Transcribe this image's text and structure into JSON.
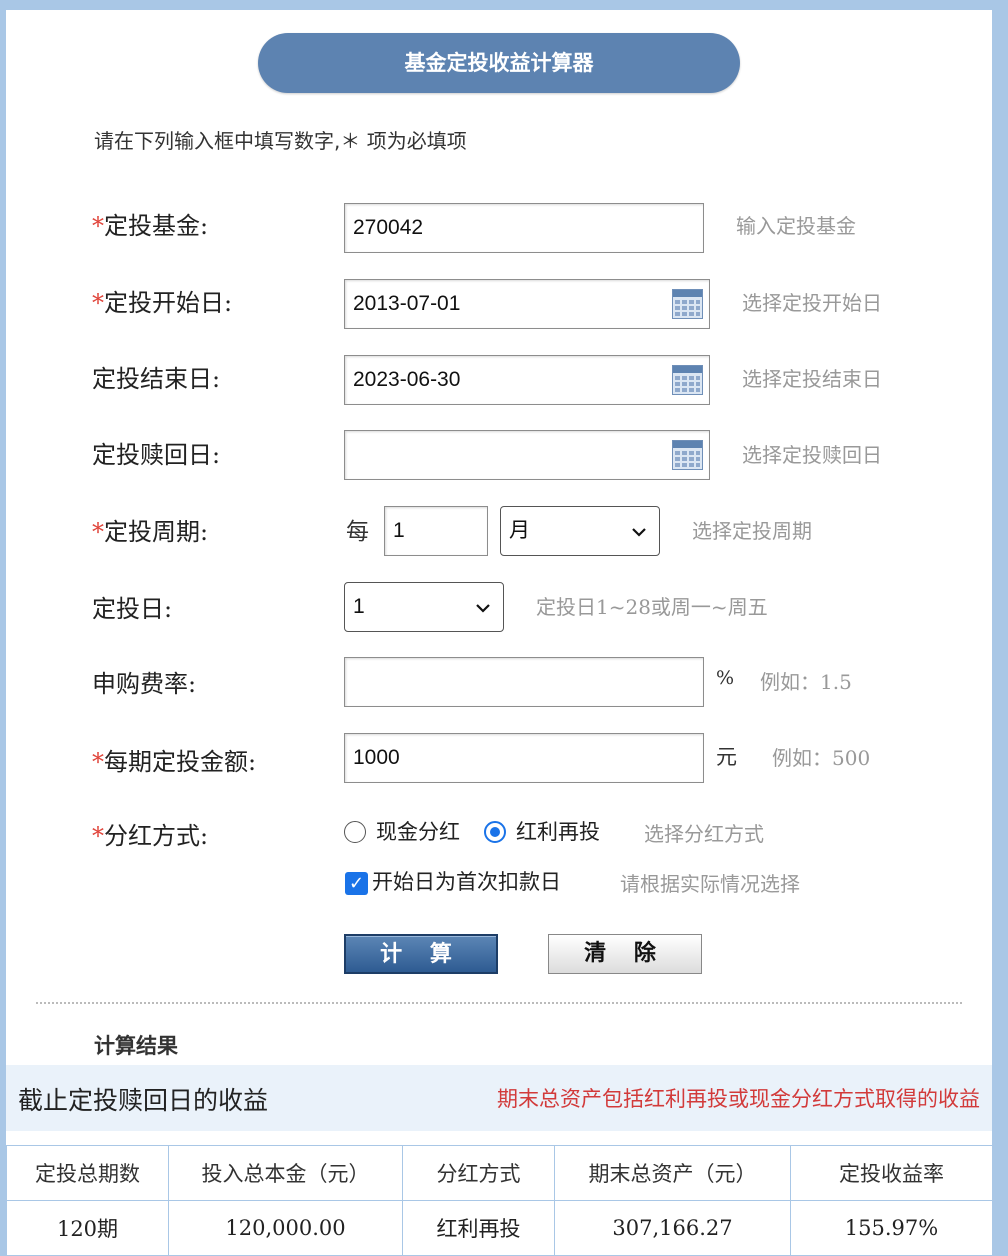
{
  "title": "基金定投收益计算器",
  "intro": "请在下列输入框中填写数字,＊ 项为必填项",
  "form": {
    "fund": {
      "required_mark": "*",
      "label": "定投基金:",
      "value": "270042",
      "hint": "输入定投基金"
    },
    "start_date": {
      "required_mark": "*",
      "label": "定投开始日:",
      "value": "2013-07-01",
      "hint": "选择定投开始日",
      "icon": "calendar-icon"
    },
    "end_date": {
      "label": "定投结束日:",
      "value": "2023-06-30",
      "hint": "选择定投结束日",
      "icon": "calendar-icon"
    },
    "redeem_date": {
      "label": "定投赎回日:",
      "value": "",
      "hint": "选择定投赎回日",
      "icon": "calendar-icon"
    },
    "period": {
      "required_mark": "*",
      "label": "定投周期:",
      "prefix": "每",
      "count": "1",
      "unit_selected": "月",
      "hint": "选择定投周期"
    },
    "invest_day": {
      "label": "定投日:",
      "selected": "1",
      "hint": "定投日1~28或周一~周五"
    },
    "fee_rate": {
      "label": "申购费率:",
      "value": "",
      "unit": "%",
      "hint": "例如：1.5"
    },
    "amount": {
      "required_mark": "*",
      "label": "每期定投金额:",
      "value": "1000",
      "unit": "元",
      "hint": "例如：500"
    },
    "dividend": {
      "required_mark": "*",
      "label": "分红方式:",
      "option_cash": "现金分红",
      "option_reinvest": "红利再投",
      "selected": "红利再投",
      "hint": "选择分红方式"
    },
    "first_debit": {
      "label": "开始日为首次扣款日",
      "checked": true,
      "hint": "请根据实际情况选择"
    }
  },
  "buttons": {
    "calculate": "计 算",
    "clear": "清 除"
  },
  "result": {
    "section_title": "计算结果",
    "band_title": "截止定投赎回日的收益",
    "band_note": "期末总资产包括红利再投或现金分红方式取得的收益",
    "headers": [
      "定投总期数",
      "投入总本金（元）",
      "分红方式",
      "期末总资产（元）",
      "定投收益率"
    ],
    "row": [
      "120期",
      "120,000.00",
      "红利再投",
      "307,166.27",
      "155.97%"
    ]
  },
  "colors": {
    "accent": "#5d83b1",
    "border": "#a9c7e6",
    "required": "#e0443a",
    "highlight": "#c63a3a"
  }
}
